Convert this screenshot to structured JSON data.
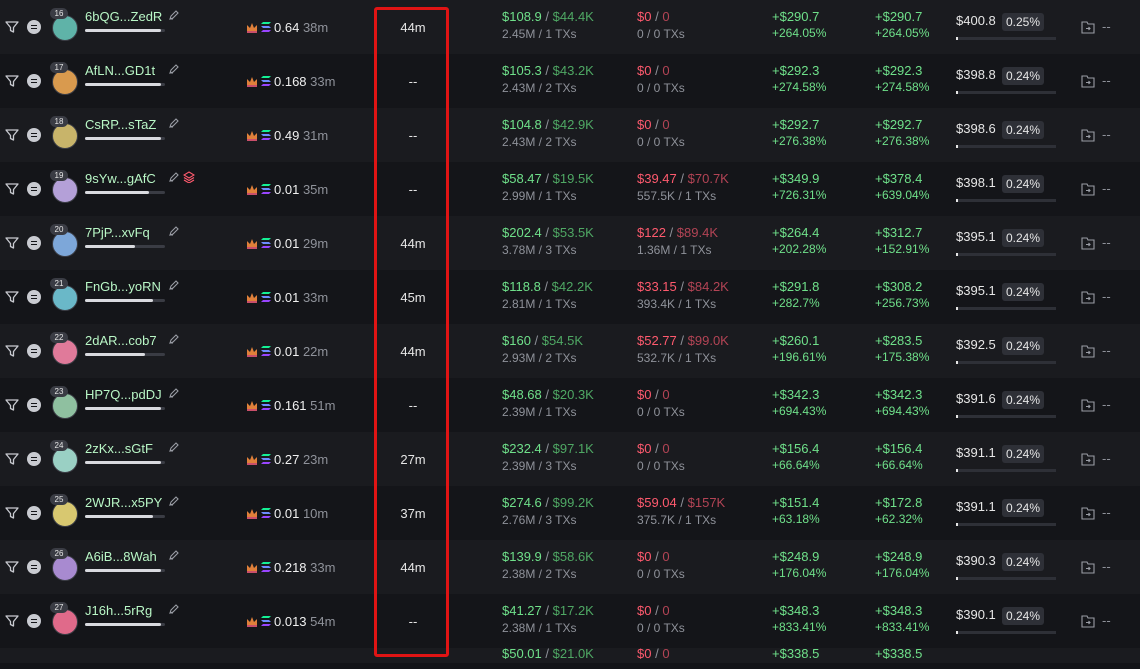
{
  "colors": {
    "profit": "#6fe08a",
    "loss": "#ff5a6e",
    "highlight": "#e01414",
    "background": "#131418"
  },
  "icons": {
    "filter": "filter-icon",
    "menu": "menu-icon",
    "edit": "edit-icon",
    "crown": "crown-icon",
    "sol": "sol-icon",
    "share": "share-icon",
    "layers": "layers-icon"
  },
  "rows": [
    {
      "rank": "16",
      "name": "6bQG...ZedR",
      "name_bar": 0.95,
      "balance": "0.64",
      "balance_age": "38m",
      "hold_time": "44m",
      "buy_usd": "$108.9",
      "buy_mc": "$44.4K",
      "buy_sub": "2.45M / 1 TXs",
      "sell_usd": "$0",
      "sell_mc": "0",
      "sell_sub": "0 / 0 TXs",
      "pnl_usd": "+$290.7",
      "pnl_pct": "+264.05%",
      "pnl2_usd": "+$290.7",
      "pnl2_pct": "+264.05%",
      "remaining": "$400.8",
      "remaining_pct": "0.25%",
      "remaining_bar": 0.02,
      "share_dash": "--",
      "avatar_color": "#5fb3a8",
      "layers": false
    },
    {
      "rank": "17",
      "name": "AfLN...GD1t",
      "name_bar": 0.95,
      "balance": "0.168",
      "balance_age": "33m",
      "hold_time": "--",
      "buy_usd": "$105.3",
      "buy_mc": "$43.2K",
      "buy_sub": "2.43M / 2 TXs",
      "sell_usd": "$0",
      "sell_mc": "0",
      "sell_sub": "0 / 0 TXs",
      "pnl_usd": "+$292.3",
      "pnl_pct": "+274.58%",
      "pnl2_usd": "+$292.3",
      "pnl2_pct": "+274.58%",
      "remaining": "$398.8",
      "remaining_pct": "0.24%",
      "remaining_bar": 0.02,
      "share_dash": "--",
      "avatar_color": "#d99a4e",
      "layers": false
    },
    {
      "rank": "18",
      "name": "CsRP...sTaZ",
      "name_bar": 0.95,
      "balance": "0.49",
      "balance_age": "31m",
      "hold_time": "--",
      "buy_usd": "$104.8",
      "buy_mc": "$42.9K",
      "buy_sub": "2.43M / 2 TXs",
      "sell_usd": "$0",
      "sell_mc": "0",
      "sell_sub": "0 / 0 TXs",
      "pnl_usd": "+$292.7",
      "pnl_pct": "+276.38%",
      "pnl2_usd": "+$292.7",
      "pnl2_pct": "+276.38%",
      "remaining": "$398.6",
      "remaining_pct": "0.24%",
      "remaining_bar": 0.02,
      "share_dash": "--",
      "avatar_color": "#c8b46a",
      "layers": false
    },
    {
      "rank": "19",
      "name": "9sYw...gAfC",
      "name_bar": 0.8,
      "balance": "0.01",
      "balance_age": "35m",
      "hold_time": "--",
      "buy_usd": "$58.47",
      "buy_mc": "$19.5K",
      "buy_sub": "2.99M / 1 TXs",
      "sell_usd": "$39.47",
      "sell_mc": "$70.7K",
      "sell_sub": "557.5K / 1 TXs",
      "pnl_usd": "+$349.9",
      "pnl_pct": "+726.31%",
      "pnl2_usd": "+$378.4",
      "pnl2_pct": "+639.04%",
      "remaining": "$398.1",
      "remaining_pct": "0.24%",
      "remaining_bar": 0.02,
      "share_dash": "--",
      "avatar_color": "#b4a0d8",
      "layers": true
    },
    {
      "rank": "20",
      "name": "7PjP...xvFq",
      "name_bar": 0.62,
      "balance": "0.01",
      "balance_age": "29m",
      "hold_time": "44m",
      "buy_usd": "$202.4",
      "buy_mc": "$53.5K",
      "buy_sub": "3.78M / 3 TXs",
      "sell_usd": "$122",
      "sell_mc": "$89.4K",
      "sell_sub": "1.36M / 1 TXs",
      "pnl_usd": "+$264.4",
      "pnl_pct": "+202.28%",
      "pnl2_usd": "+$312.7",
      "pnl2_pct": "+152.91%",
      "remaining": "$395.1",
      "remaining_pct": "0.24%",
      "remaining_bar": 0.02,
      "share_dash": "--",
      "avatar_color": "#7da7d9",
      "layers": false
    },
    {
      "rank": "21",
      "name": "FnGb...yoRN",
      "name_bar": 0.85,
      "balance": "0.01",
      "balance_age": "33m",
      "hold_time": "45m",
      "buy_usd": "$118.8",
      "buy_mc": "$42.2K",
      "buy_sub": "2.81M / 1 TXs",
      "sell_usd": "$33.15",
      "sell_mc": "$84.2K",
      "sell_sub": "393.4K / 1 TXs",
      "pnl_usd": "+$291.8",
      "pnl_pct": "+282.7%",
      "pnl2_usd": "+$308.2",
      "pnl2_pct": "+256.73%",
      "remaining": "$395.1",
      "remaining_pct": "0.24%",
      "remaining_bar": 0.02,
      "share_dash": "--",
      "avatar_color": "#6ab8c8",
      "layers": false
    },
    {
      "rank": "22",
      "name": "2dAR...cob7",
      "name_bar": 0.75,
      "balance": "0.01",
      "balance_age": "22m",
      "hold_time": "44m",
      "buy_usd": "$160",
      "buy_mc": "$54.5K",
      "buy_sub": "2.93M / 2 TXs",
      "sell_usd": "$52.77",
      "sell_mc": "$99.0K",
      "sell_sub": "532.7K / 1 TXs",
      "pnl_usd": "+$260.1",
      "pnl_pct": "+196.61%",
      "pnl2_usd": "+$283.5",
      "pnl2_pct": "+175.38%",
      "remaining": "$392.5",
      "remaining_pct": "0.24%",
      "remaining_bar": 0.02,
      "share_dash": "--",
      "avatar_color": "#e07a9a",
      "layers": false
    },
    {
      "rank": "23",
      "name": "HP7Q...pdDJ",
      "name_bar": 0.95,
      "balance": "0.161",
      "balance_age": "51m",
      "hold_time": "--",
      "buy_usd": "$48.68",
      "buy_mc": "$20.3K",
      "buy_sub": "2.39M / 1 TXs",
      "sell_usd": "$0",
      "sell_mc": "0",
      "sell_sub": "0 / 0 TXs",
      "pnl_usd": "+$342.3",
      "pnl_pct": "+694.43%",
      "pnl2_usd": "+$342.3",
      "pnl2_pct": "+694.43%",
      "remaining": "$391.6",
      "remaining_pct": "0.24%",
      "remaining_bar": 0.02,
      "share_dash": "--",
      "avatar_color": "#8fc0a0",
      "layers": false
    },
    {
      "rank": "24",
      "name": "2zKx...sGtF",
      "name_bar": 0.95,
      "balance": "0.27",
      "balance_age": "23m",
      "hold_time": "27m",
      "buy_usd": "$232.4",
      "buy_mc": "$97.1K",
      "buy_sub": "2.39M / 3 TXs",
      "sell_usd": "$0",
      "sell_mc": "0",
      "sell_sub": "0 / 0 TXs",
      "pnl_usd": "+$156.4",
      "pnl_pct": "+66.64%",
      "pnl2_usd": "+$156.4",
      "pnl2_pct": "+66.64%",
      "remaining": "$391.1",
      "remaining_pct": "0.24%",
      "remaining_bar": 0.02,
      "share_dash": "--",
      "avatar_color": "#9ad0c4",
      "layers": false
    },
    {
      "rank": "25",
      "name": "2WJR...x5PY",
      "name_bar": 0.85,
      "balance": "0.01",
      "balance_age": "10m",
      "hold_time": "37m",
      "buy_usd": "$274.6",
      "buy_mc": "$99.2K",
      "buy_sub": "2.76M / 3 TXs",
      "sell_usd": "$59.04",
      "sell_mc": "$157K",
      "sell_sub": "375.7K / 1 TXs",
      "pnl_usd": "+$151.4",
      "pnl_pct": "+63.18%",
      "pnl2_usd": "+$172.8",
      "pnl2_pct": "+62.32%",
      "remaining": "$391.1",
      "remaining_pct": "0.24%",
      "remaining_bar": 0.02,
      "share_dash": "--",
      "avatar_color": "#d8c870",
      "layers": false
    },
    {
      "rank": "26",
      "name": "A6iB...8Wah",
      "name_bar": 0.95,
      "balance": "0.218",
      "balance_age": "33m",
      "hold_time": "44m",
      "buy_usd": "$139.9",
      "buy_mc": "$58.6K",
      "buy_sub": "2.38M / 2 TXs",
      "sell_usd": "$0",
      "sell_mc": "0",
      "sell_sub": "0 / 0 TXs",
      "pnl_usd": "+$248.9",
      "pnl_pct": "+176.04%",
      "pnl2_usd": "+$248.9",
      "pnl2_pct": "+176.04%",
      "remaining": "$390.3",
      "remaining_pct": "0.24%",
      "remaining_bar": 0.02,
      "share_dash": "--",
      "avatar_color": "#a88ad0",
      "layers": false
    },
    {
      "rank": "27",
      "name": "J16h...5rRg",
      "name_bar": 0.95,
      "balance": "0.013",
      "balance_age": "54m",
      "hold_time": "--",
      "buy_usd": "$41.27",
      "buy_mc": "$17.2K",
      "buy_sub": "2.38M / 1 TXs",
      "sell_usd": "$0",
      "sell_mc": "0",
      "sell_sub": "0 / 0 TXs",
      "pnl_usd": "+$348.3",
      "pnl_pct": "+833.41%",
      "pnl2_usd": "+$348.3",
      "pnl2_pct": "+833.41%",
      "remaining": "$390.1",
      "remaining_pct": "0.24%",
      "remaining_bar": 0.02,
      "share_dash": "--",
      "avatar_color": "#e06a8a",
      "layers": false
    }
  ],
  "partial_row": {
    "buy_usd": "$50.01",
    "buy_mc": "$21.0K",
    "sell_usd": "$0",
    "sell_mc": "0",
    "pnl_usd": "+$338.5",
    "pnl2_usd": "+$338.5"
  }
}
